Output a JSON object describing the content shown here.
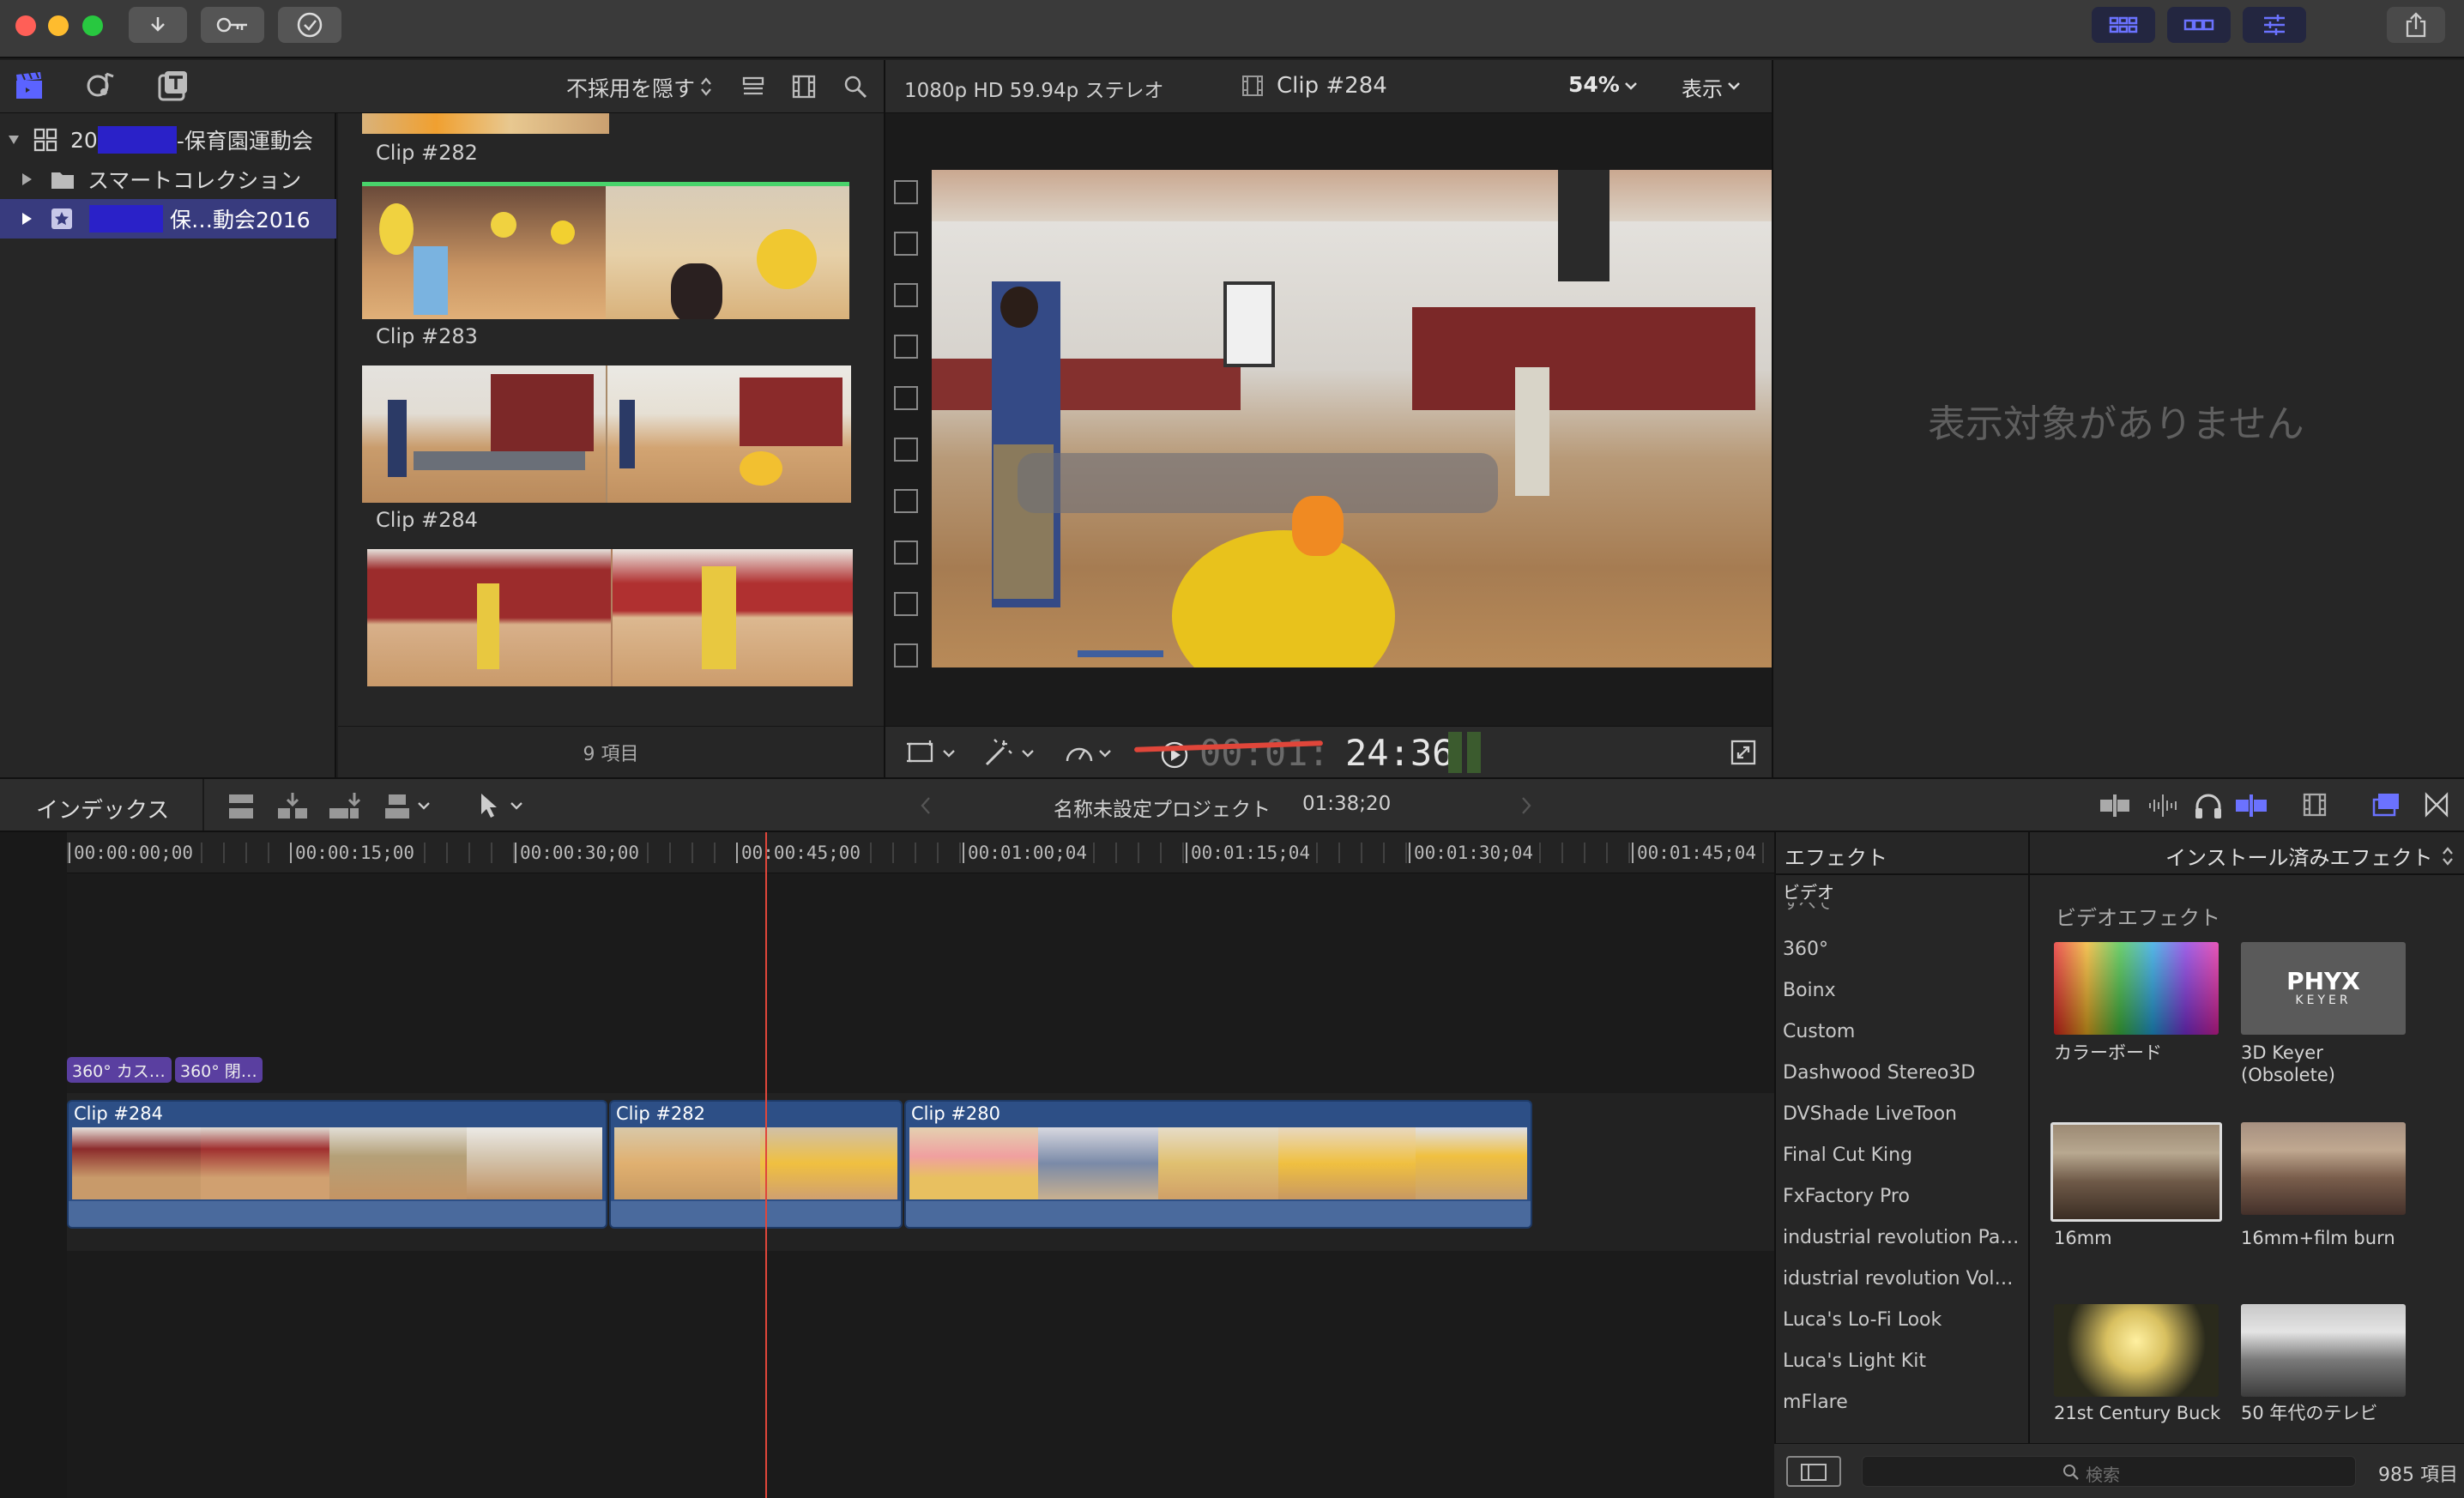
{
  "browser": {
    "hide_rejected_label": "不採用を隠す",
    "library": {
      "name_prefix": "20",
      "name_suffix": "-保育園運動会",
      "smart_collections": "スマートコレクション",
      "event_name": "保…動会2016"
    },
    "clips": [
      {
        "label": "Clip #282"
      },
      {
        "label": "Clip #283"
      },
      {
        "label": "Clip #284"
      }
    ],
    "item_count": "9 項目"
  },
  "viewer": {
    "format": "1080p HD 59.94p ステレオ",
    "clip_name": "Clip #284",
    "zoom": "54%",
    "view_menu": "表示",
    "timecode_dim": "00:01:",
    "timecode": "24:36"
  },
  "inspector": {
    "empty_message": "表示対象がありません"
  },
  "timeline": {
    "index_label": "インデックス",
    "project_name": "名称未設定プロジェクト",
    "duration": "01:38;20",
    "ruler": [
      "00:00:00;00",
      "00:00:15;00",
      "00:00:30;00",
      "00:00:45;00",
      "00:01:00;04",
      "00:01:15;04",
      "00:01:30;04",
      "00:01:45;04"
    ],
    "effect_badges": [
      "360° カス…",
      "360° 閉…"
    ],
    "clips": [
      "Clip #284",
      "Clip #282",
      "Clip #280"
    ]
  },
  "effects": {
    "header_left": "エフェクト",
    "header_right": "インストール済みエフェクト",
    "category_header": "ビデオ",
    "categories": [
      "すべて",
      "360°",
      "Boinx",
      "Custom",
      "Dashwood Stereo3D",
      "DVShade LiveToon",
      "Final Cut King",
      "FxFactory Pro",
      "industrial revolution Parti…",
      "idustrial revolution Volu…",
      "Luca's Lo-Fi Look",
      "Luca's Light Kit",
      "mFlare"
    ],
    "section_title": "ビデオエフェクト",
    "items": [
      {
        "name": "カラーボード"
      },
      {
        "name": "3D Keyer (Obsolete)",
        "logo_line1": "PHYX",
        "logo_line2": "KEYER"
      },
      {
        "name": "16mm"
      },
      {
        "name": "16mm+film burn"
      },
      {
        "name": "21st Century Buck"
      },
      {
        "name": "50 年代のテレビ"
      }
    ],
    "search_placeholder": "検索",
    "count": "985 項目"
  },
  "colors": {
    "accent": "#5b63ff",
    "selection": "#3a3e8c",
    "clip_blue": "#2d4f86",
    "playhead": "#e0463a",
    "effect_badge": "#5a3fa0"
  }
}
